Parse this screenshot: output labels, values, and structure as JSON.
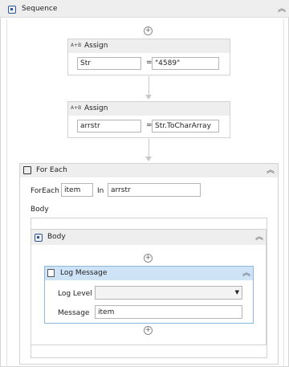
{
  "sequence": {
    "title": "Sequence",
    "collapse_glyph": "︽"
  },
  "assign1": {
    "icon_text": "A+B",
    "title": "Assign",
    "to": "Str",
    "eq": "=",
    "value": "\"4589\""
  },
  "assign2": {
    "icon_text": "A+B",
    "title": "Assign",
    "to": "arrstr",
    "eq": "=",
    "value": "Str.ToCharArray"
  },
  "foreach": {
    "title": "For Each",
    "foreach_label": "ForEach",
    "item": "item",
    "in_label": "In",
    "collection": "arrstr",
    "body_label": "Body",
    "collapse_glyph": "︽"
  },
  "body_seq": {
    "title": "Body",
    "collapse_glyph": "︽"
  },
  "log": {
    "title": "Log Message",
    "level_label": "Log Level",
    "level_value": "",
    "message_label": "Message",
    "message_value": "item",
    "collapse_glyph": "︽",
    "dropdown_glyph": "▼"
  },
  "plus_glyph": "+"
}
